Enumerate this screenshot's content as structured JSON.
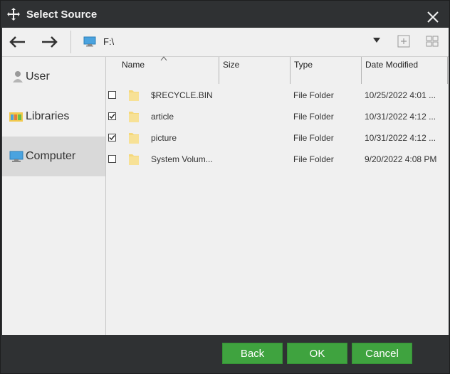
{
  "window": {
    "title": "Select Source"
  },
  "toolbar": {
    "path": "F:\\"
  },
  "sidebar": {
    "items": [
      {
        "label": "User",
        "icon": "user-icon"
      },
      {
        "label": "Libraries",
        "icon": "libraries-icon"
      },
      {
        "label": "Computer",
        "icon": "computer-icon",
        "active": true
      }
    ]
  },
  "table": {
    "columns": [
      "Name",
      "Size",
      "Type",
      "Date Modified"
    ],
    "sort_column": "Name",
    "rows": [
      {
        "name": "$RECYCLE.BIN",
        "size": "",
        "type": "File Folder",
        "date": "10/25/2022 4:01 ...",
        "checked": false
      },
      {
        "name": "article",
        "size": "",
        "type": "File Folder",
        "date": "10/31/2022 4:12 ...",
        "checked": true
      },
      {
        "name": "picture",
        "size": "",
        "type": "File Folder",
        "date": "10/31/2022 4:12 ...",
        "checked": true
      },
      {
        "name": "System Volum...",
        "size": "",
        "type": "File Folder",
        "date": "9/20/2022 4:08 PM",
        "checked": false
      }
    ]
  },
  "footer": {
    "back_label": "Back",
    "ok_label": "OK",
    "cancel_label": "Cancel"
  },
  "colors": {
    "button_green": "#3fa33f",
    "frame_dark": "#2f3133",
    "panel_bg": "#f0f0f0",
    "folder_yellow": "#f5d87a"
  }
}
